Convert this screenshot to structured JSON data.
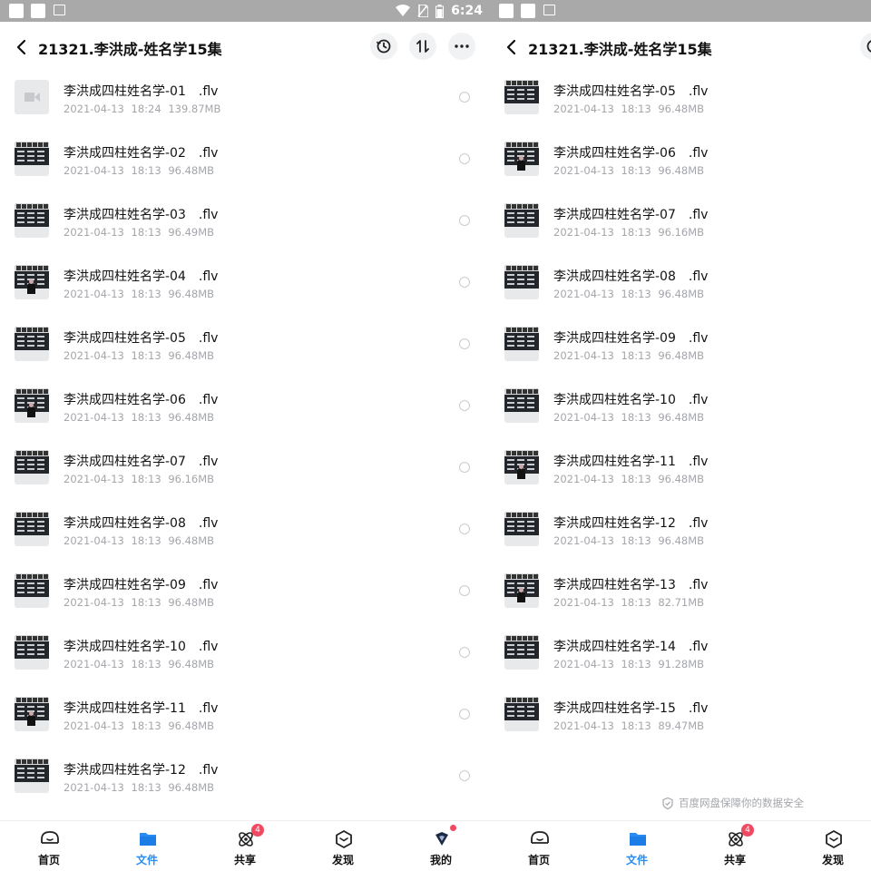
{
  "status": {
    "time": "6:24"
  },
  "folder_title": "21321.李洪成-姓名学15集",
  "files": [
    {
      "name": "李洪成四柱姓名学-01　.flv",
      "date": "2021-04-13",
      "time": "18:24",
      "size": "139.87MB",
      "thumb": "video-placeholder"
    },
    {
      "name": "李洪成四柱姓名学-02　.flv",
      "date": "2021-04-13",
      "time": "18:13",
      "size": "96.48MB",
      "thumb": "board"
    },
    {
      "name": "李洪成四柱姓名学-03　.flv",
      "date": "2021-04-13",
      "time": "18:13",
      "size": "96.49MB",
      "thumb": "board"
    },
    {
      "name": "李洪成四柱姓名学-04　.flv",
      "date": "2021-04-13",
      "time": "18:13",
      "size": "96.48MB",
      "thumb": "presenter"
    },
    {
      "name": "李洪成四柱姓名学-05　.flv",
      "date": "2021-04-13",
      "time": "18:13",
      "size": "96.48MB",
      "thumb": "board"
    },
    {
      "name": "李洪成四柱姓名学-06　.flv",
      "date": "2021-04-13",
      "time": "18:13",
      "size": "96.48MB",
      "thumb": "presenter"
    },
    {
      "name": "李洪成四柱姓名学-07　.flv",
      "date": "2021-04-13",
      "time": "18:13",
      "size": "96.16MB",
      "thumb": "board"
    },
    {
      "name": "李洪成四柱姓名学-08　.flv",
      "date": "2021-04-13",
      "time": "18:13",
      "size": "96.48MB",
      "thumb": "board"
    },
    {
      "name": "李洪成四柱姓名学-09　.flv",
      "date": "2021-04-13",
      "time": "18:13",
      "size": "96.48MB",
      "thumb": "board"
    },
    {
      "name": "李洪成四柱姓名学-10　.flv",
      "date": "2021-04-13",
      "time": "18:13",
      "size": "96.48MB",
      "thumb": "board"
    },
    {
      "name": "李洪成四柱姓名学-11　.flv",
      "date": "2021-04-13",
      "time": "18:13",
      "size": "96.48MB",
      "thumb": "presenter"
    },
    {
      "name": "李洪成四柱姓名学-12　.flv",
      "date": "2021-04-13",
      "time": "18:13",
      "size": "96.48MB",
      "thumb": "board"
    },
    {
      "name": "李洪成四柱姓名学-13　.flv",
      "date": "2021-04-13",
      "time": "18:13",
      "size": "82.71MB",
      "thumb": "presenter"
    },
    {
      "name": "李洪成四柱姓名学-14　.flv",
      "date": "2021-04-13",
      "time": "18:13",
      "size": "91.28MB",
      "thumb": "board"
    },
    {
      "name": "李洪成四柱姓名学-15　.flv",
      "date": "2021-04-13",
      "time": "18:13",
      "size": "89.47MB",
      "thumb": "board"
    }
  ],
  "footer_note": "百度网盘保障你的数据安全",
  "tabs": [
    {
      "label": "首页",
      "icon": "home-icon"
    },
    {
      "label": "文件",
      "icon": "folder-icon",
      "active": true
    },
    {
      "label": "共享",
      "icon": "share-icon",
      "badge": "4"
    },
    {
      "label": "发现",
      "icon": "discover-icon"
    },
    {
      "label": "我的",
      "icon": "profile-icon",
      "dot": true
    }
  ],
  "colors": {
    "accent": "#2a8cf2",
    "badge": "#ef4a62",
    "status_bar": "#a9a9a9",
    "meta_text": "#a4a6ab"
  }
}
